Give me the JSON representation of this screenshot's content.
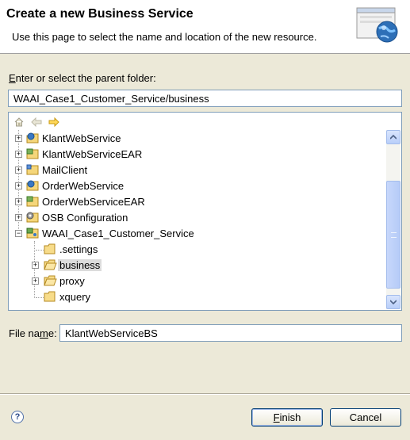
{
  "header": {
    "title": "Create a new Business Service",
    "description": "Use this page to select the name and location of the new resource."
  },
  "parent_folder": {
    "label_first": "E",
    "label_rest": "nter or select the parent folder:",
    "value": "WAAI_Case1_Customer_Service/business"
  },
  "tree_toolbar": [
    "home-icon",
    "back-arrow-icon",
    "forward-arrow-icon"
  ],
  "tree": {
    "items": [
      {
        "label": "KlantWebService",
        "icon": "web-project-icon",
        "expanded": false,
        "selected": false
      },
      {
        "label": "KlantWebServiceEAR",
        "icon": "ear-project-icon",
        "expanded": false,
        "selected": false
      },
      {
        "label": "MailClient",
        "icon": "project-folder-icon",
        "expanded": false,
        "selected": false
      },
      {
        "label": "OrderWebService",
        "icon": "web-project-icon",
        "expanded": false,
        "selected": false
      },
      {
        "label": "OrderWebServiceEAR",
        "icon": "ear-project-icon",
        "expanded": false,
        "selected": false
      },
      {
        "label": "OSB Configuration",
        "icon": "osb-config-icon",
        "expanded": false,
        "selected": false
      },
      {
        "label": "WAAI_Case1_Customer_Service",
        "icon": "osb-project-icon",
        "expanded": true,
        "selected": false
      },
      {
        "label": ".settings",
        "icon": "folder-icon",
        "expanded": null,
        "selected": false
      },
      {
        "label": "business",
        "icon": "open-folder-icon",
        "expanded": false,
        "selected": true
      },
      {
        "label": "proxy",
        "icon": "open-folder-icon",
        "expanded": false,
        "selected": false
      },
      {
        "label": "xquery",
        "icon": "folder-icon",
        "expanded": null,
        "selected": false
      }
    ]
  },
  "file_name": {
    "label_a": "File na",
    "label_u": "m",
    "label_b": "e:",
    "value": "KlantWebServiceBS"
  },
  "buttons": {
    "finish_u": "F",
    "finish_rest": "inish",
    "cancel": "Cancel"
  },
  "colors": {
    "dialog_bg": "#ece9d8",
    "accent_border": "#003c74",
    "input_border": "#7f9db9"
  }
}
